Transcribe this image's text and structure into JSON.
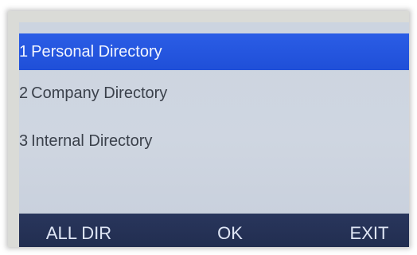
{
  "directory_menu": {
    "items": [
      {
        "number": "1",
        "label": "Personal Directory",
        "selected": true
      },
      {
        "number": "2",
        "label": "Company Directory",
        "selected": false
      },
      {
        "number": "3",
        "label": "Internal Directory",
        "selected": false
      }
    ]
  },
  "softkeys": {
    "left": "ALL DIR",
    "middle": "OK",
    "right": "EXIT"
  },
  "colors": {
    "selection": "#1f4fd8",
    "softkey_bar": "#25315a",
    "screen_background": "#cdd4df"
  }
}
